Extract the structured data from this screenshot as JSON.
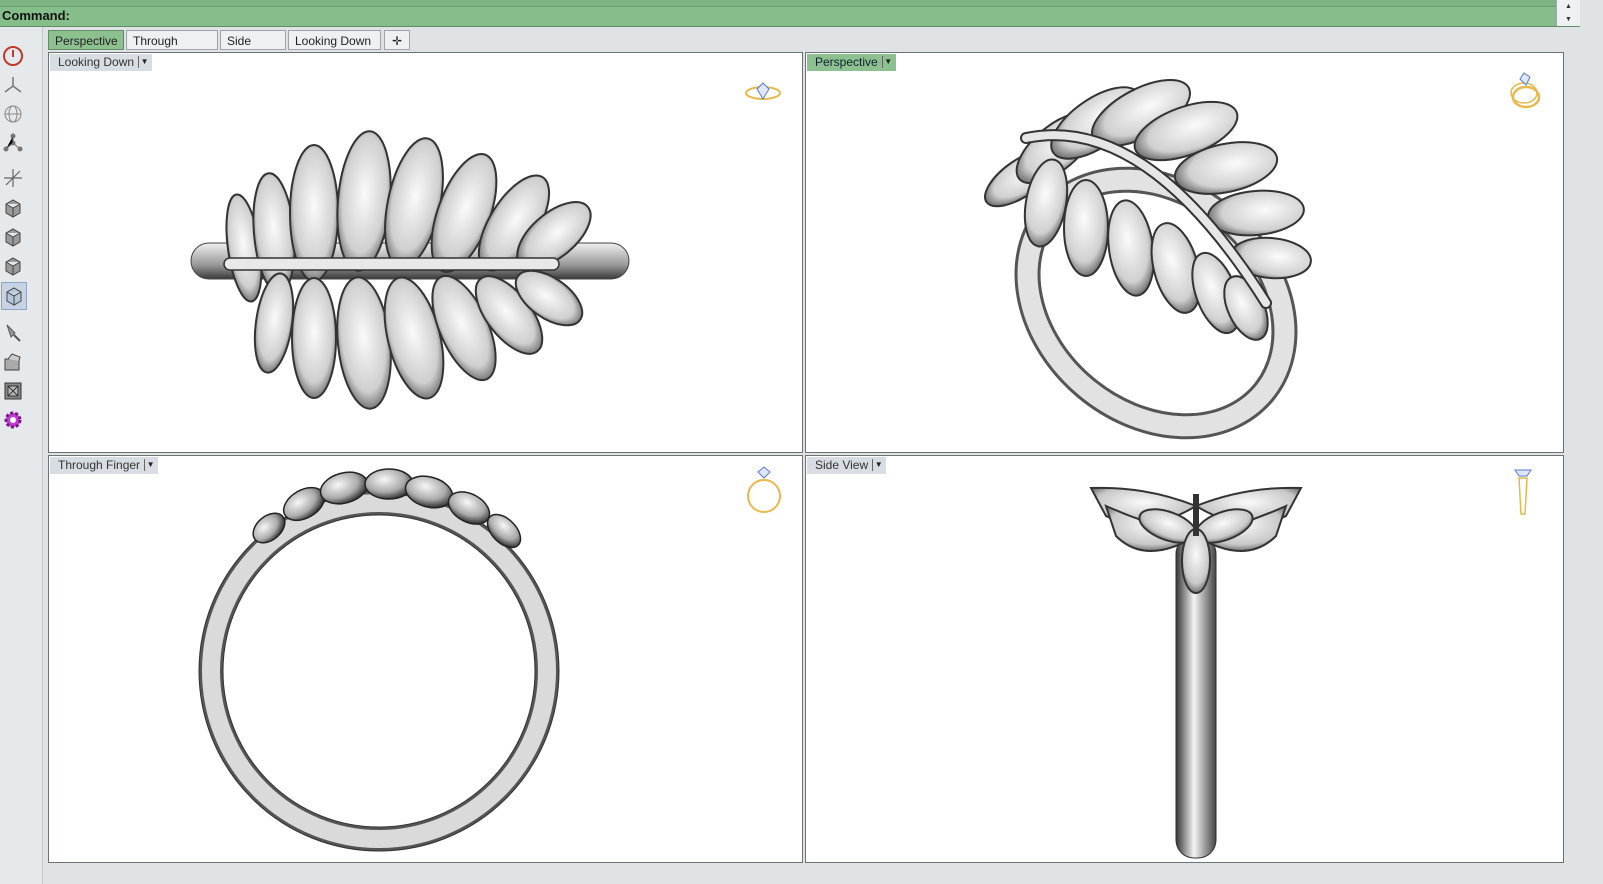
{
  "command": {
    "label": "Command:"
  },
  "tabs": [
    {
      "label": "Perspective",
      "active": true
    },
    {
      "label": "Through Finger",
      "active": false
    },
    {
      "label": "Side View",
      "active": false
    },
    {
      "label": "Looking Down",
      "active": false
    }
  ],
  "add_tab_icon": "plus-icon",
  "viewports": {
    "top_left": {
      "label": "Looking Down",
      "icon": "ring-top-icon"
    },
    "top_right": {
      "label": "Perspective",
      "icon": "ring-perspective-icon"
    },
    "bottom_left": {
      "label": "Through Finger",
      "icon": "ring-front-icon"
    },
    "bottom_right": {
      "label": "Side View",
      "icon": "ring-side-icon"
    }
  },
  "toolbar_icons": [
    "power-icon",
    "gumball-icon",
    "globe-icon",
    "vertex-icon",
    "axes-icon",
    "cube-icon",
    "cube-icon",
    "cube-icon",
    "cube-icon",
    "lamp-icon",
    "render-icon",
    "frame-icon",
    "settings-icon"
  ],
  "colors": {
    "accent_green": "#86be8b",
    "active_tab": "#8cc08f",
    "ring_icon_gold": "#e8b84a",
    "gem_blue": "#5b7bd6"
  }
}
